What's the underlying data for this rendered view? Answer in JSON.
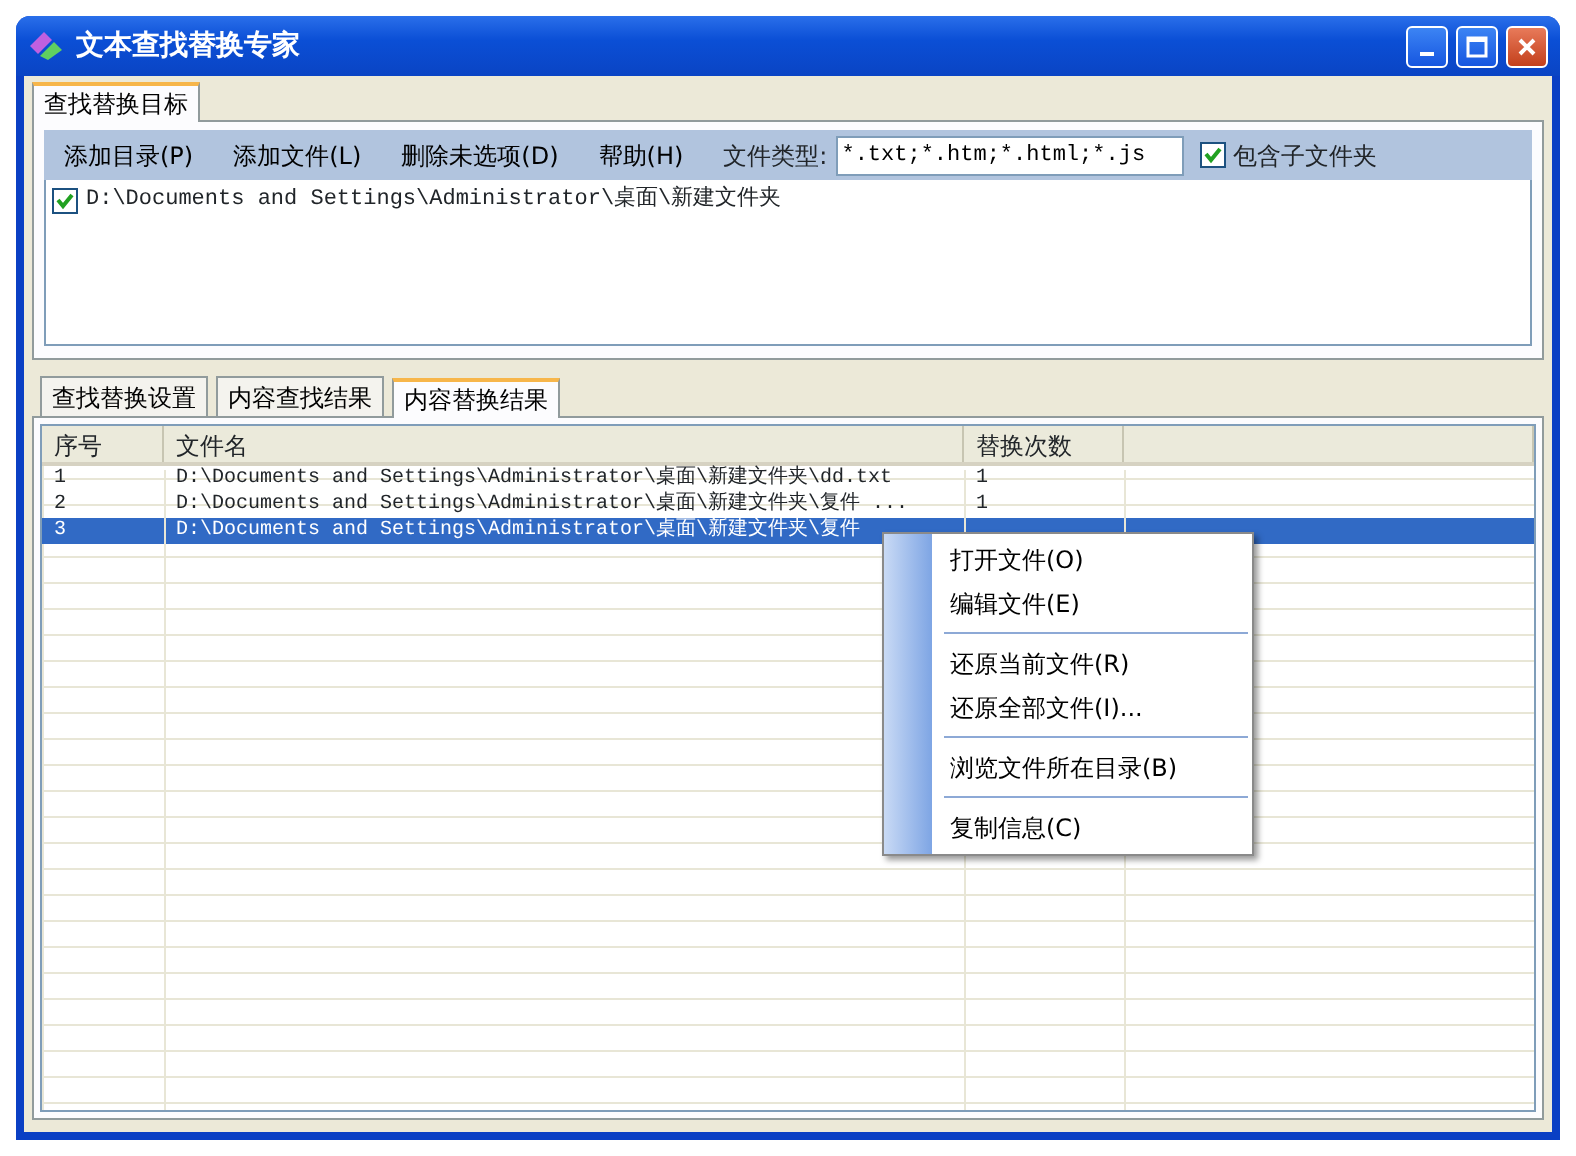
{
  "window": {
    "title": "文本查找替换专家"
  },
  "top_tabs": [
    {
      "label": "查找替换目标",
      "selected": true
    }
  ],
  "toolbar": {
    "buttons": [
      "添加目录(P)",
      "添加文件(L)",
      "删除未选项(D)",
      "帮助(H)"
    ],
    "file_type_label": "文件类型:",
    "file_type_value": "*.txt;*.htm;*.html;*.js",
    "include_subfolders": {
      "label": "包含子文件夹",
      "checked": true
    }
  },
  "folders": [
    {
      "path": "D:\\Documents and Settings\\Administrator\\桌面\\新建文件夹",
      "checked": true
    }
  ],
  "bottom_tabs": [
    {
      "label": "查找替换设置",
      "selected": false
    },
    {
      "label": "内容查找结果",
      "selected": false
    },
    {
      "label": "内容替换结果",
      "selected": true
    }
  ],
  "table": {
    "columns": [
      "序号",
      "文件名",
      "替换次数"
    ],
    "rows": [
      {
        "cells": [
          "1",
          "D:\\Documents and Settings\\Administrator\\桌面\\新建文件夹\\dd.txt",
          "1"
        ],
        "selected": false
      },
      {
        "cells": [
          "2",
          "D:\\Documents and Settings\\Administrator\\桌面\\新建文件夹\\复件 ...",
          "1"
        ],
        "selected": false
      },
      {
        "cells": [
          "3",
          "D:\\Documents and Settings\\Administrator\\桌面\\新建文件夹\\复件"
        ],
        "selected": true
      }
    ]
  },
  "context_menu": [
    {
      "kind": "item",
      "label": "打开文件(O)"
    },
    {
      "kind": "item",
      "label": "编辑文件(E)"
    },
    {
      "kind": "separator"
    },
    {
      "kind": "item",
      "label": "还原当前文件(R)"
    },
    {
      "kind": "item",
      "label": "还原全部文件(I)..."
    },
    {
      "kind": "separator"
    },
    {
      "kind": "item",
      "label": "浏览文件所在目录(B)"
    },
    {
      "kind": "separator"
    },
    {
      "kind": "item",
      "label": "复制信息(C)"
    }
  ]
}
